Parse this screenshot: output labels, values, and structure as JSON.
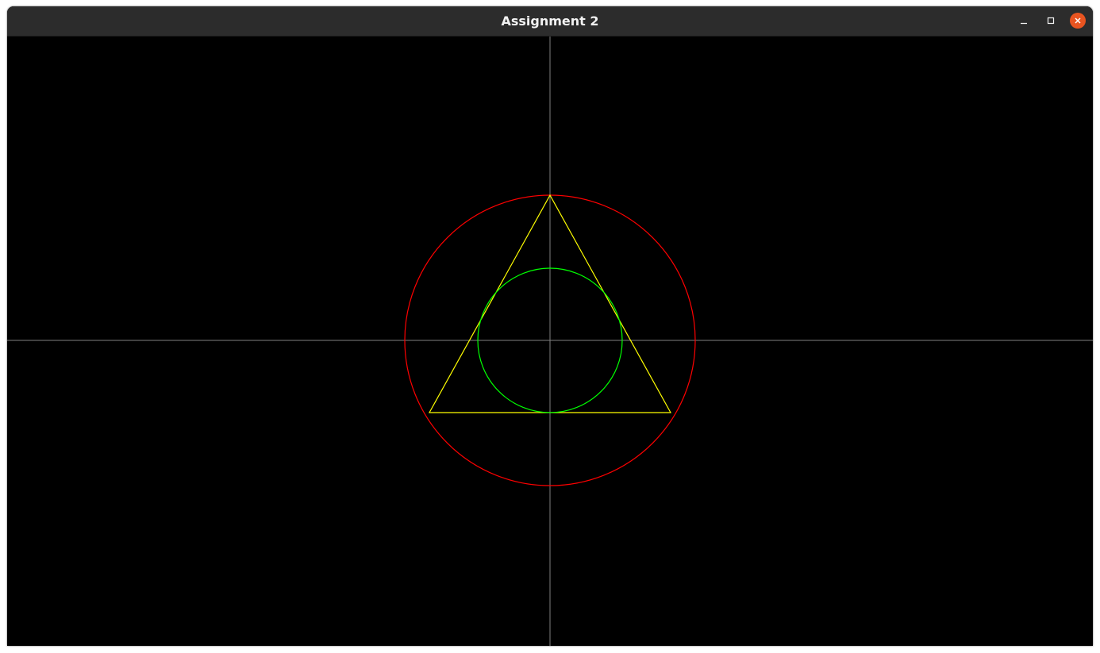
{
  "window": {
    "title": "Assignment 2",
    "controls": {
      "minimize": "minimize-icon",
      "maximize": "maximize-icon",
      "close": "close-icon"
    }
  },
  "scene": {
    "background_color": "#000000",
    "axes_color": "#808080",
    "circumcircle_color": "#ff0000",
    "triangle_color": "#ffff00",
    "incircle_color": "#00ff00",
    "shapes": [
      "coordinate-axes",
      "circumscribed-circle",
      "equilateral-triangle",
      "inscribed-circle"
    ]
  }
}
